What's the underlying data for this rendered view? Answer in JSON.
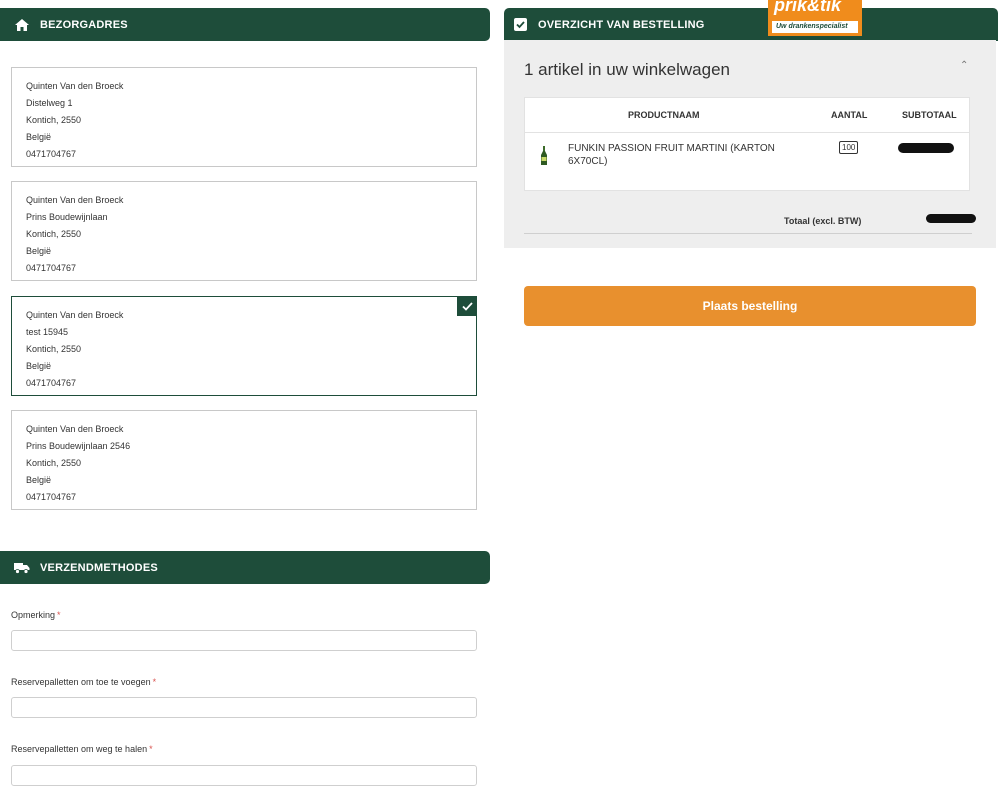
{
  "delivery": {
    "header": "BEZORGADRES",
    "addresses": [
      {
        "name": "Quinten Van den Broeck",
        "street": "Distelweg 1",
        "city": "Kontich, 2550",
        "country": "België",
        "phone": "0471704767",
        "selected": false
      },
      {
        "name": "Quinten Van den Broeck",
        "street": "Prins Boudewijnlaan",
        "city": "Kontich, 2550",
        "country": "België",
        "phone": "0471704767",
        "selected": false
      },
      {
        "name": "Quinten Van den Broeck",
        "street": "test 15945",
        "city": "Kontich, 2550",
        "country": "België",
        "phone": "0471704767",
        "selected": true
      },
      {
        "name": "Quinten Van den Broeck",
        "street": "Prins Boudewijnlaan 2546",
        "city": "Kontich, 2550",
        "country": "België",
        "phone": "0471704767",
        "selected": false
      }
    ]
  },
  "shipping": {
    "header": "VERZENDMETHODES",
    "fields": [
      {
        "label": "Opmerking",
        "required_mark": "*",
        "value": ""
      },
      {
        "label": "Reservepalletten om toe te voegen",
        "required_mark": "*",
        "value": ""
      },
      {
        "label": "Reservepalletten om weg te halen",
        "required_mark": "*",
        "value": ""
      }
    ]
  },
  "summary": {
    "header": "OVERZICHT VAN BESTELLING",
    "cart_title": "1 artikel in uw winkelwagen",
    "collapse_icon": "chevron-up-icon",
    "columns": {
      "product": "PRODUCTNAAM",
      "quantity": "AANTAL",
      "subtotal": "SUBTOTAAL"
    },
    "items": [
      {
        "name": "FUNKIN PASSION FRUIT MARTINI (KARTON 6X70CL)",
        "quantity": "100"
      }
    ],
    "total_label": "Totaal (excl. BTW)",
    "place_order": "Plaats bestelling"
  },
  "logo": {
    "main": "prik&tik",
    "tagline": "Uw drankenspecialist"
  },
  "colors": {
    "brand_green": "#1e4d3a",
    "accent_orange": "#e8902e",
    "panel_grey": "#eeeeee"
  }
}
